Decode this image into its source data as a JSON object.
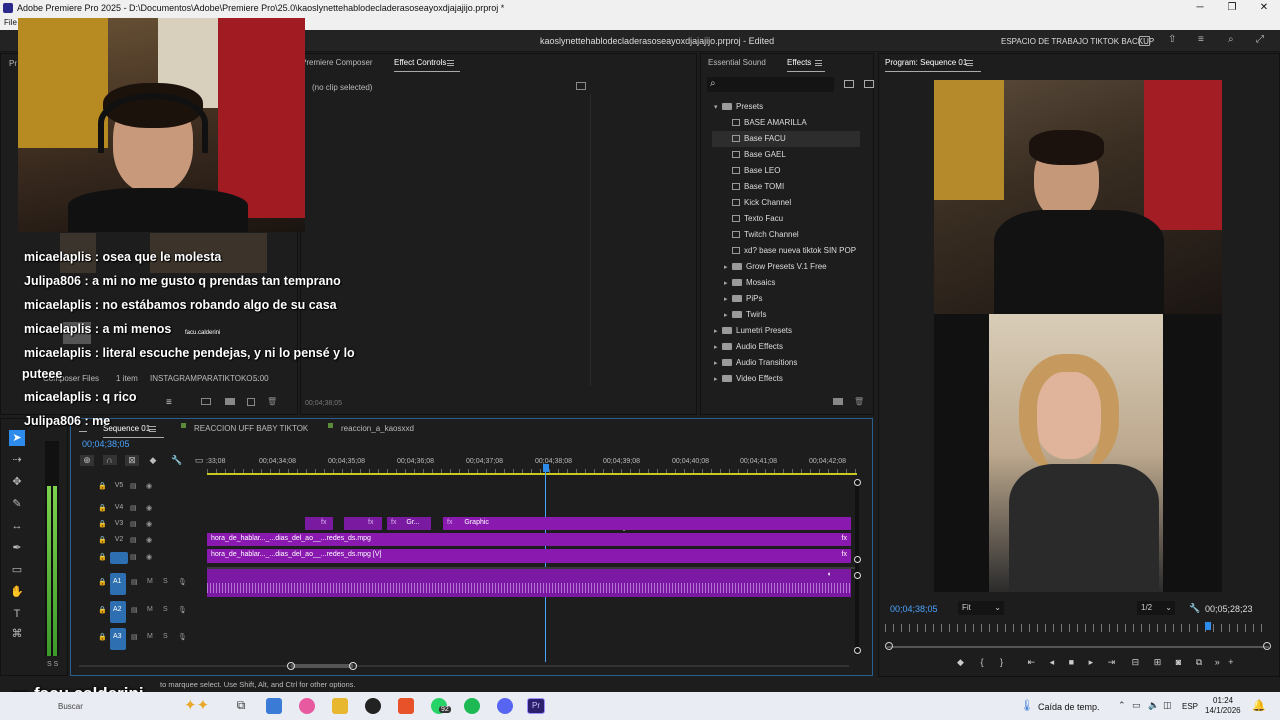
{
  "window": {
    "title": "Adobe Premiere Pro 2025 - D:\\Documentos\\Adobe\\Premiere Pro\\25.0\\kaoslynettehablodecladerasoseayoxdjajajijo.prproj *",
    "menu_visible": "File"
  },
  "header": {
    "doc_title": "kaoslynettehablodecladerasoseayoxdjajajijo.prproj - Edited",
    "workspace": "ESPACIO DE TRABAJO TIKTOK BACKUP"
  },
  "source_panel": {
    "tab_partial": "Pr",
    "tab_composer": "Premiere Composer",
    "tab_effect_controls": "Effect Controls",
    "no_clip": "(no clip selected)",
    "timecode": "00;04;38;05"
  },
  "project_panel": {
    "files_label": "Composer Files",
    "items": "1 item",
    "bin_name": "INSTAGRAMPARATIKTOKO...",
    "duration": "5:00"
  },
  "effects_panel": {
    "tab_sound": "Essential Sound",
    "tab_effects": "Effects",
    "tree": [
      {
        "label": "Presets",
        "kind": "folder",
        "depth": 0,
        "open": true
      },
      {
        "label": "BASE AMARILLA",
        "kind": "preset",
        "depth": 1
      },
      {
        "label": "Base FACU",
        "kind": "preset",
        "depth": 1,
        "selected": true
      },
      {
        "label": "Base GAEL",
        "kind": "preset",
        "depth": 1
      },
      {
        "label": "Base LEO",
        "kind": "preset",
        "depth": 1
      },
      {
        "label": "Base TOMI",
        "kind": "preset",
        "depth": 1
      },
      {
        "label": "Kick Channel",
        "kind": "preset",
        "depth": 1
      },
      {
        "label": "Texto Facu",
        "kind": "preset",
        "depth": 1
      },
      {
        "label": "Twitch Channel",
        "kind": "preset",
        "depth": 1
      },
      {
        "label": "xd? base nueva tiktok SIN POP",
        "kind": "preset",
        "depth": 1
      },
      {
        "label": "Grow Presets V.1 Free",
        "kind": "folder",
        "depth": 1
      },
      {
        "label": "Mosaics",
        "kind": "folder",
        "depth": 1
      },
      {
        "label": "PiPs",
        "kind": "folder",
        "depth": 1
      },
      {
        "label": "Twirls",
        "kind": "folder",
        "depth": 1
      },
      {
        "label": "Lumetri Presets",
        "kind": "folder",
        "depth": 0
      },
      {
        "label": "Audio Effects",
        "kind": "folder",
        "depth": 0
      },
      {
        "label": "Audio Transitions",
        "kind": "folder",
        "depth": 0
      },
      {
        "label": "Video Effects",
        "kind": "folder",
        "depth": 0
      }
    ]
  },
  "program_monitor": {
    "tab": "Program: Sequence 01",
    "timecode": "00;04;38;05",
    "fit": "Fit",
    "resolution": "1/2",
    "duration": "00;05;28;23"
  },
  "timeline": {
    "tabs": [
      "Sequence 01",
      "REACCION UFF BABY TIKTOK",
      "reaccion_a_kaosxxd"
    ],
    "timecode": "00;04;38;05",
    "ruler": [
      ":33;08",
      "00;04;34;08",
      "00;04;35;08",
      "00;04;36;08",
      "00;04;37;08",
      "00;04;38;08",
      "00;04;39;08",
      "00;04;40;08",
      "00;04;41;08",
      "00;04;42;08"
    ],
    "video_tracks": [
      "V5",
      "V4",
      "V3",
      "V2",
      "V1"
    ],
    "audio_tracks": [
      "A1",
      "A2",
      "A3"
    ],
    "track_ms": [
      "M",
      "S"
    ],
    "clip_graphic_short": "Gr...",
    "clip_graphic": "Graphic",
    "fx_badge": "fx",
    "clip_v2": "hora_de_hablar..._...dias_del_ao__...redes_ds.mpg",
    "clip_v1": "hora_de_hablar..._...dias_del_ao__...redes_ds.mpg [V]",
    "status": "to marquee select. Use Shift, Alt, and Ctrl for other options."
  },
  "chat": [
    {
      "user": "micaelaplis",
      "msg": " : osea que le molesta"
    },
    {
      "user": "Julipa806",
      "msg": " : a mi no me gusto q prendas tan temprano"
    },
    {
      "user": "micaelaplis",
      "msg": " : no estábamos robando algo de su casa"
    },
    {
      "user": "micaelaplis",
      "msg": " : a mi menos"
    },
    {
      "user": "micaelaplis",
      "msg": " : literal escuche pendejas, y ni lo pensé y lo"
    },
    {
      "user": "",
      "msg": "puteee"
    },
    {
      "user": "micaelaplis",
      "msg": " : q rico"
    },
    {
      "user": "Julipa806",
      "msg": " : me"
    }
  ],
  "watermark": "facu.calderini",
  "webcam_tag": "facu.calderini",
  "taskbar": {
    "search": "Buscar",
    "weather": "Caída de temp.",
    "lang": "ESP",
    "time": "01:24",
    "date": "14/1/2026",
    "badge": "92"
  },
  "colors": {
    "clip": "#8a19b0",
    "accent": "#2d8ceb",
    "panel": "#1d1d1d"
  }
}
